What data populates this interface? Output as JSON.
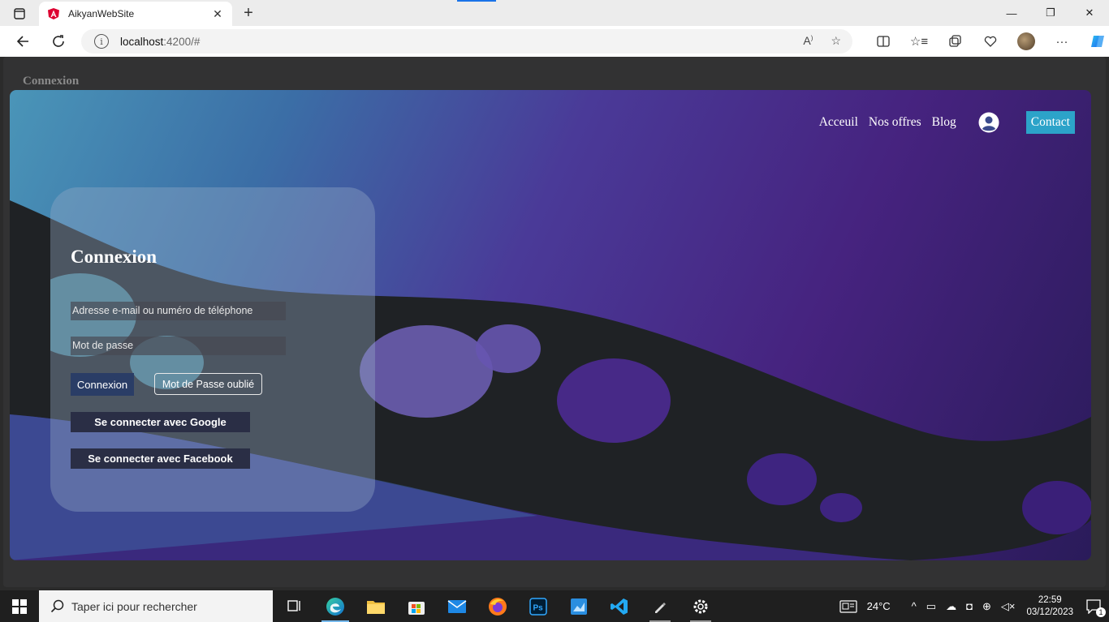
{
  "browser": {
    "tab_title": "AikyanWebSite",
    "url_host": "localhost",
    "url_path": ":4200/#",
    "colors": {
      "tab_accent": "#1a73e8"
    }
  },
  "page": {
    "heading": "Connexion",
    "nav": {
      "links": [
        "Acceuil",
        "Nos offres",
        "Blog"
      ],
      "contact": "Contact"
    },
    "login": {
      "title": "Connexion",
      "email_placeholder": "Adresse e-mail ou numéro de téléphone",
      "password_placeholder": "Mot de passe",
      "submit_label": "Connexion",
      "forgot_label": "Mot de Passe oublié",
      "google_label": "Se connecter avec Google",
      "facebook_label": "Se connecter avec Facebook"
    },
    "colors": {
      "contact_button": "#2ca3c9",
      "primary_button": "#2a3d66",
      "social_button": "#2a2e45",
      "gradient_start": "#4a95b8",
      "gradient_end": "#2a1b5a"
    }
  },
  "taskbar": {
    "search_placeholder": "Taper ici pour rechercher",
    "weather": "24°C",
    "time": "22:59",
    "date": "03/12/2023",
    "notification_count": "1",
    "apps": [
      "task-view",
      "edge",
      "file-explorer",
      "microsoft-store",
      "mail",
      "firefox",
      "photoshop",
      "paint",
      "vscode",
      "pen-tool",
      "settings"
    ]
  }
}
